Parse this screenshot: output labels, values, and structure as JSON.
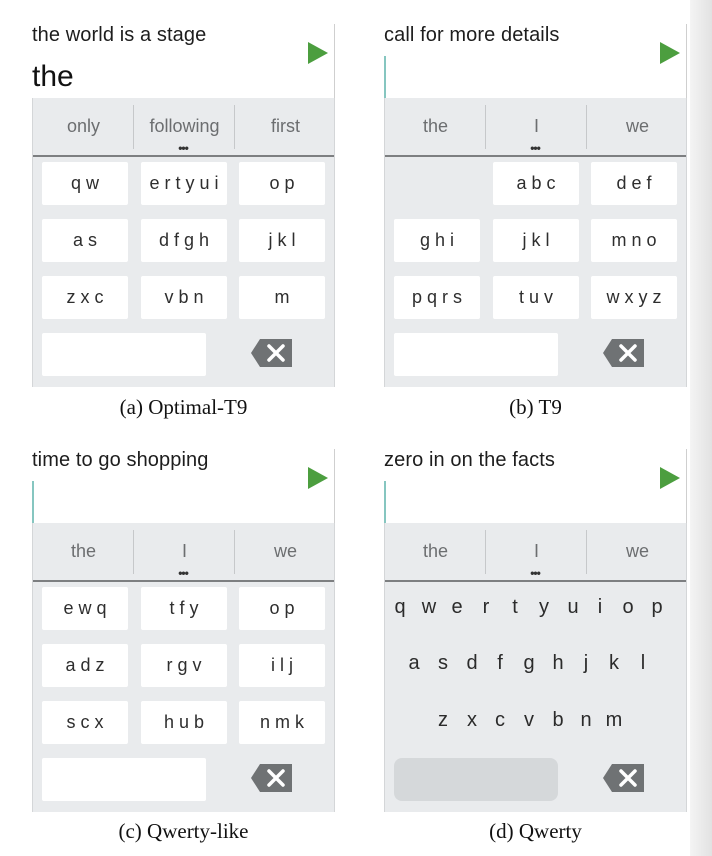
{
  "panels": [
    {
      "phrase": "the world is a stage",
      "typed": "the",
      "suggestions": [
        "only",
        "following",
        "first"
      ],
      "keys": [
        [
          "q w",
          "e r t y u i",
          "o p"
        ],
        [
          "a s",
          "d f g h",
          "j k l"
        ],
        [
          "z x c",
          "v b n",
          "m"
        ]
      ],
      "caption": "(a) Optimal-T9"
    },
    {
      "phrase": "call for more details",
      "typed": "",
      "suggestions": [
        "the",
        "I",
        "we"
      ],
      "keys": [
        [
          "",
          "a b c",
          "d e f"
        ],
        [
          "g h i",
          "j k l",
          "m n o"
        ],
        [
          "p q r s",
          "t u v",
          "w x y z"
        ]
      ],
      "caption": "(b) T9"
    },
    {
      "phrase": "time to go shopping",
      "typed": "",
      "suggestions": [
        "the",
        "I",
        "we"
      ],
      "keys": [
        [
          "e w q",
          "t f y",
          "o p"
        ],
        [
          "a d z",
          "r g v",
          "i l j"
        ],
        [
          "s c x",
          "h u b",
          "n m k"
        ]
      ],
      "caption": "(c) Qwerty-like"
    },
    {
      "phrase": "zero in on the facts",
      "typed": "",
      "suggestions": [
        "the",
        "I",
        "we"
      ],
      "qwerty_rows": [
        [
          "q",
          "w",
          "e",
          "r",
          "t",
          "y",
          "u",
          "i",
          "o",
          "p"
        ],
        [
          "a",
          "s",
          "d",
          "f",
          "g",
          "h",
          "j",
          "k",
          "l"
        ],
        [
          "z",
          "x",
          "c",
          "v",
          "b",
          "n",
          "m"
        ]
      ],
      "caption": "(d) Qwerty"
    }
  ],
  "icons": {
    "send": "send-arrow-icon",
    "backspace": "backspace-icon",
    "more": "more-dots-icon"
  },
  "colors": {
    "send": "#4c9e3f",
    "cursor": "#86c6c0",
    "keyboard_bg": "#e9ebed",
    "key": "#ffffff",
    "backspace": "#6f7274"
  }
}
